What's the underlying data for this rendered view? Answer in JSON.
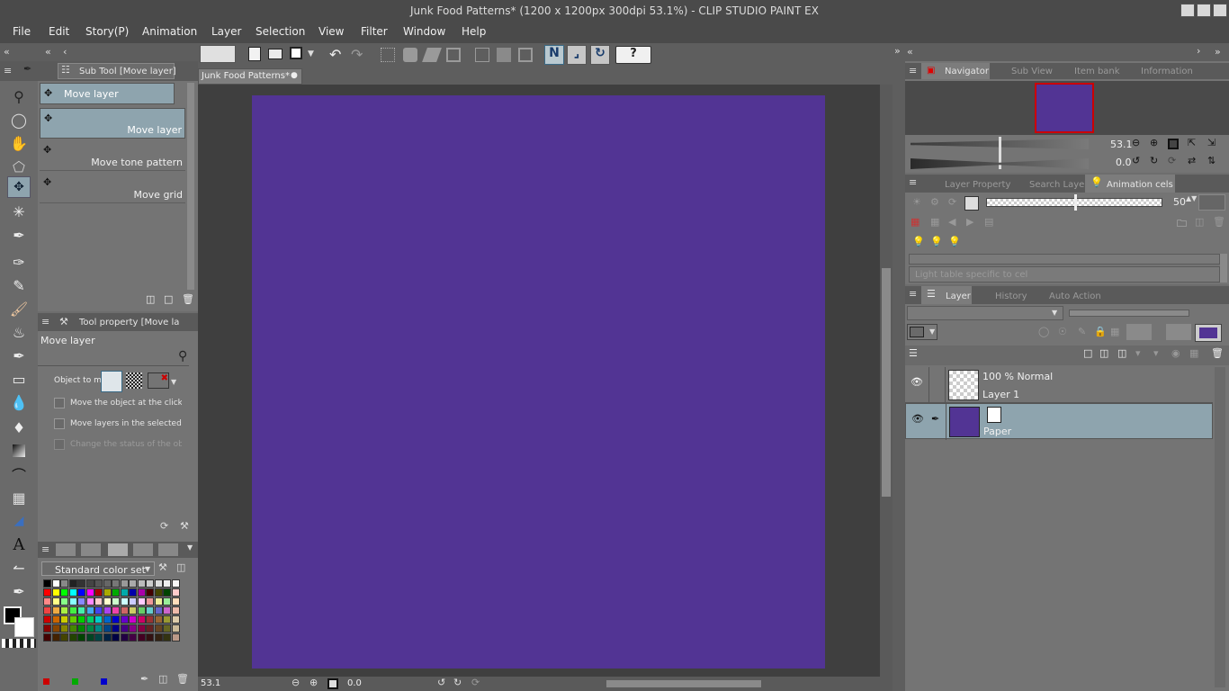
{
  "window": {
    "title": "Junk Food Patterns* (1200 x 1200px 300dpi 53.1%)  - CLIP STUDIO PAINT EX"
  },
  "menu": [
    "File",
    "Edit",
    "Story(P)",
    "Animation",
    "Layer",
    "Selection",
    "View",
    "Filter",
    "Window",
    "Help"
  ],
  "doc_tab": {
    "label": "Junk Food Patterns*"
  },
  "canvas": {
    "color": "#523494",
    "zoom": "53.1",
    "angle": "0.0"
  },
  "sub_tool": {
    "header": "Sub Tool [Move layer]",
    "group_label": "Move layer",
    "items": [
      "Move layer",
      "Move tone pattern",
      "Move grid"
    ]
  },
  "tool_property": {
    "header": "Tool property [Move la",
    "name": "Move layer",
    "object_label": "Object to mo",
    "options": [
      "Move the object at the clicked pos",
      "Move layers in the selected area",
      "Change the status of the object to"
    ]
  },
  "color_set": {
    "name": "Standard color set"
  },
  "navigator": {
    "tabs": [
      "Navigator",
      "Sub View",
      "Item bank",
      "Information"
    ],
    "zoom": "53.1",
    "angle": "0.0"
  },
  "animation_panel": {
    "tabs": [
      "Layer Property",
      "Search Layer",
      "Animation cels"
    ],
    "value": "50",
    "light_table": "Light table specific to cel"
  },
  "layer_panel": {
    "tabs": [
      "Layer",
      "History",
      "Auto Action"
    ],
    "layers": [
      {
        "mode": "100 % Normal",
        "name": "Layer 1"
      },
      {
        "mode": "",
        "name": "Paper"
      }
    ]
  },
  "colors": {
    "accent": "#523494",
    "selected_row": "#8ea4ae"
  }
}
